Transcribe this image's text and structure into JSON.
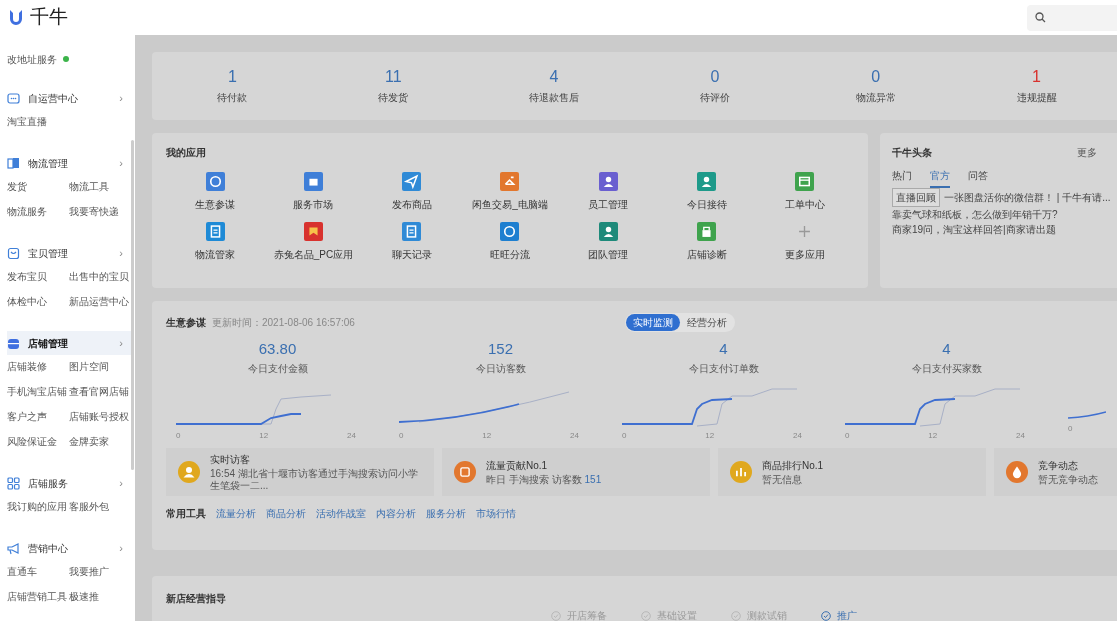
{
  "header": {
    "logo": "千牛"
  },
  "sidebar": {
    "top_links": [
      {
        "label": "改地址服务",
        "badge": true
      }
    ],
    "groups": [
      {
        "title": "自运营中心",
        "chevron": "›",
        "selected": false,
        "links": [
          "淘宝直播"
        ]
      },
      {
        "title": "物流管理",
        "chevron": "›",
        "selected": false,
        "links": [
          "发货",
          "物流工具",
          "物流服务",
          "我要寄快递"
        ]
      },
      {
        "title": "宝贝管理",
        "chevron": "›",
        "selected": false,
        "links": [
          "发布宝贝",
          "出售中的宝贝",
          "体检中心",
          "新品运营中心"
        ]
      },
      {
        "title": "店铺管理",
        "chevron": "›",
        "selected": true,
        "links": [
          "店铺装修",
          "图片空间",
          "手机淘宝店铺",
          "查看官网店铺",
          "客户之声",
          "店铺账号授权",
          "风险保证金",
          "金牌卖家"
        ]
      },
      {
        "title": "店铺服务",
        "chevron": "›",
        "selected": false,
        "links": [
          "我订购的应用",
          "客服外包"
        ]
      },
      {
        "title": "营销中心",
        "chevron": "›",
        "selected": false,
        "links": [
          "直通车",
          "我要推广",
          "店铺营销工具",
          "极速推"
        ]
      }
    ]
  },
  "stats": [
    {
      "value": "1",
      "label": "待付款",
      "alert": false
    },
    {
      "value": "11",
      "label": "待发货",
      "alert": false
    },
    {
      "value": "4",
      "label": "待退款售后",
      "alert": false
    },
    {
      "value": "0",
      "label": "待评价",
      "alert": false
    },
    {
      "value": "0",
      "label": "物流异常",
      "alert": false
    },
    {
      "value": "1",
      "label": "违规提醒",
      "alert": true
    }
  ],
  "apps": {
    "title": "我的应用",
    "items": [
      {
        "label": "生意参谋",
        "color": "#3f7fd8"
      },
      {
        "label": "服务市场",
        "color": "#3f7fd8"
      },
      {
        "label": "发布商品",
        "color": "#2f8ad6"
      },
      {
        "label": "闲鱼交易_电脑端",
        "color": "#e2772e"
      },
      {
        "label": "员工管理",
        "color": "#6a5fd0"
      },
      {
        "label": "今日接待",
        "color": "#1e9a8a"
      },
      {
        "label": "工单中心",
        "color": "#3fa34d"
      },
      {
        "label": "物流管家",
        "color": "#1e8ad6"
      },
      {
        "label": "赤兔名品_PC应用",
        "color": "#d8322e"
      },
      {
        "label": "聊天记录",
        "color": "#2f8ad6"
      },
      {
        "label": "旺旺分流",
        "color": "#1e7fd0"
      },
      {
        "label": "团队管理",
        "color": "#1e8a7a"
      },
      {
        "label": "店铺诊断",
        "color": "#3fa34d"
      },
      {
        "label": "更多应用",
        "color": "#d6d6d6"
      }
    ]
  },
  "headlines": {
    "title": "千牛头条",
    "more": "更多",
    "tabs": [
      {
        "label": "热门",
        "selected": false
      },
      {
        "label": "官方",
        "selected": true
      },
      {
        "label": "问答",
        "selected": false
      }
    ],
    "items": [
      {
        "tag": "直播回顾",
        "text": "一张图盘活你的微信群！ | 千牛有请..."
      },
      {
        "text": "靠卖气球和纸板，怎么做到年销千万?"
      },
      {
        "text": "商家19问，淘宝这样回答|商家请出题"
      }
    ]
  },
  "business": {
    "title": "生意参谋",
    "updated": "更新时间：2021-08-06 16:57:06",
    "modes": [
      {
        "label": "实时监测",
        "selected": true
      },
      {
        "label": "经营分析",
        "selected": false
      }
    ],
    "metrics": [
      {
        "value": "63.80",
        "label": "今日支付金额",
        "ticks": [
          "0",
          "12",
          "24"
        ]
      },
      {
        "value": "152",
        "label": "今日访客数",
        "ticks": [
          "0",
          "12",
          "24"
        ]
      },
      {
        "value": "4",
        "label": "今日支付订单数",
        "ticks": [
          "0",
          "12",
          "24"
        ]
      },
      {
        "value": "4",
        "label": "今日支付买家数",
        "ticks": [
          "0",
          "12",
          "24"
        ]
      },
      {
        "ticks": [
          "0"
        ]
      }
    ],
    "cards": [
      {
        "title": "实时访客",
        "text": "16:54 湖北省十堰市访客通过手淘搜索访问小学生笔袋一二...",
        "color": "#e0a81e"
      },
      {
        "title": "流量贡献No.1",
        "text": "昨日 手淘搜索 访客数",
        "count": "151",
        "color": "#e2772e"
      },
      {
        "title": "商品排行No.1",
        "text": "暂无信息",
        "color": "#e0a81e"
      },
      {
        "title": "竞争动态",
        "text": "暂无竞争动态",
        "color": "#e2772e"
      }
    ],
    "tools_label": "常用工具",
    "tools": [
      "流量分析",
      "商品分析",
      "活动作战室",
      "内容分析",
      "服务分析",
      "市场行情"
    ]
  },
  "guide": {
    "title": "新店经营指导",
    "steps": [
      {
        "label": "开店筹备",
        "active": false
      },
      {
        "label": "基础设置",
        "active": false
      },
      {
        "label": "测款试销",
        "active": false
      },
      {
        "label": "推广",
        "active": true
      }
    ]
  }
}
